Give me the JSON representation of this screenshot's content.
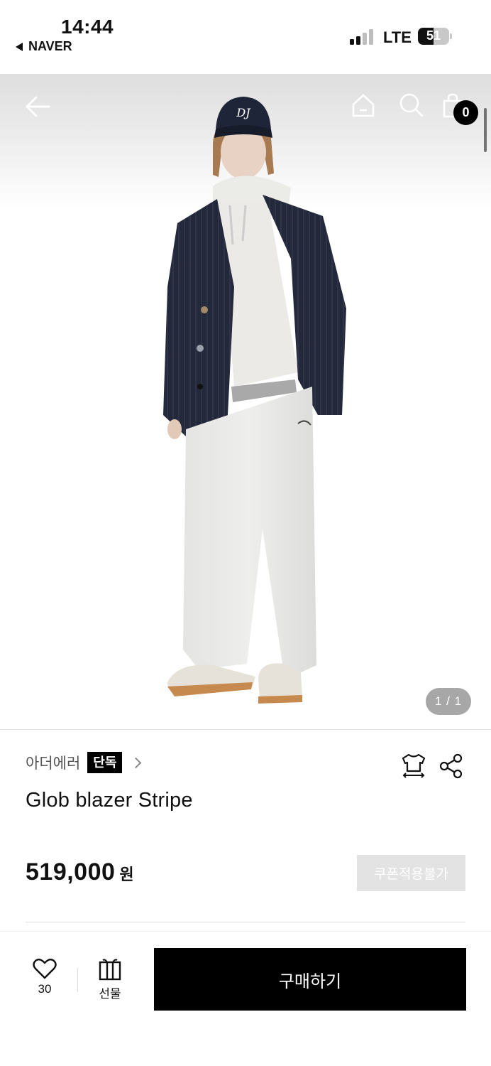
{
  "status_bar": {
    "time": "14:44",
    "back_app": "NAVER",
    "network": "LTE",
    "battery": "51",
    "battery_level": 0.51
  },
  "header": {
    "icons": [
      "back-arrow-icon",
      "home-icon",
      "search-icon",
      "cart-icon"
    ],
    "cart_count": "0"
  },
  "gallery": {
    "indicator": "1 / 1"
  },
  "product": {
    "brand": "아더에러",
    "badge": "단독",
    "name": "Glob blazer Stripe",
    "price": "519,000",
    "currency": "원",
    "coupon_label": "쿠폰적용불가"
  },
  "action_bar": {
    "like_count": "30",
    "gift_label": "선물",
    "buy_label": "구매하기"
  },
  "colors": {
    "buy_button": "#000000",
    "coupon_bg": "#e3e3e3",
    "badge_bg": "#000000"
  }
}
